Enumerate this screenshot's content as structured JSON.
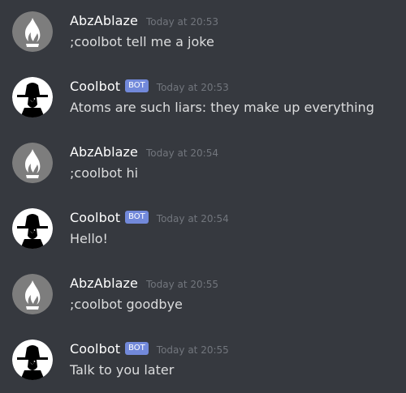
{
  "theme": {
    "background": "#36393f",
    "username_color": "#ffffff",
    "message_color": "#dcddde",
    "timestamp_color": "#72767d",
    "bot_tag_color": "#7289da"
  },
  "messages": [
    {
      "author": "AbzAblaze",
      "avatar_icon": "flame-avatar-icon",
      "is_bot": false,
      "bot_tag": "",
      "timestamp": "Today at 20:53",
      "text": ";coolbot tell me a joke"
    },
    {
      "author": "Coolbot",
      "avatar_icon": "witch-silhouette-avatar-icon",
      "is_bot": true,
      "bot_tag": "BOT",
      "timestamp": "Today at 20:53",
      "text": "Atoms are such liars: they make up everything"
    },
    {
      "author": "AbzAblaze",
      "avatar_icon": "flame-avatar-icon",
      "is_bot": false,
      "bot_tag": "",
      "timestamp": "Today at 20:54",
      "text": ";coolbot hi"
    },
    {
      "author": "Coolbot",
      "avatar_icon": "witch-silhouette-avatar-icon",
      "is_bot": true,
      "bot_tag": "BOT",
      "timestamp": "Today at 20:54",
      "text": "Hello!"
    },
    {
      "author": "AbzAblaze",
      "avatar_icon": "flame-avatar-icon",
      "is_bot": false,
      "bot_tag": "",
      "timestamp": "Today at 20:55",
      "text": ";coolbot goodbye"
    },
    {
      "author": "Coolbot",
      "avatar_icon": "witch-silhouette-avatar-icon",
      "is_bot": true,
      "bot_tag": "BOT",
      "timestamp": "Today at 20:55",
      "text": "Talk to you later"
    }
  ]
}
